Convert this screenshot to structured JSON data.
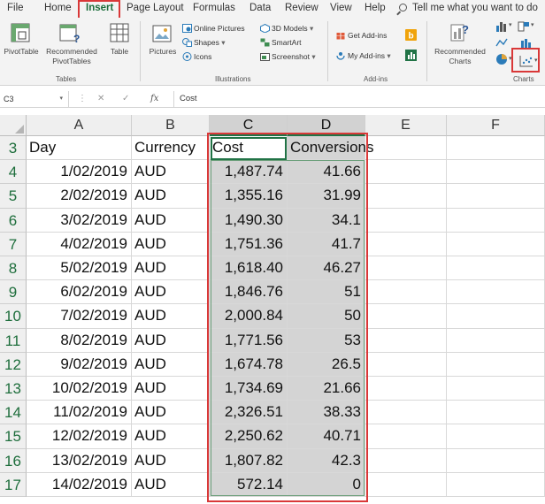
{
  "menu": {
    "tabs": [
      "File",
      "Home",
      "Insert",
      "Page Layout",
      "Formulas",
      "Data",
      "Review",
      "View",
      "Help"
    ],
    "active_tab": "Insert",
    "tell_me": "Tell me what you want to do"
  },
  "ribbon": {
    "tables": {
      "pivot_table": "PivotTable",
      "recommended_pivot_1": "Recommended",
      "recommended_pivot_2": "PivotTables",
      "table": "Table",
      "group_label": "Tables"
    },
    "illustrations": {
      "pictures": "Pictures",
      "online_pictures": "Online Pictures",
      "shapes": "Shapes",
      "icons": "Icons",
      "models_3d": "3D Models",
      "smartart": "SmartArt",
      "screenshot": "Screenshot",
      "group_label": "Illustrations"
    },
    "addins": {
      "get_addins": "Get Add-ins",
      "my_addins": "My Add-ins",
      "group_label": "Add-ins"
    },
    "charts": {
      "recommended_1": "Recommended",
      "recommended_2": "Charts",
      "group_label": "Charts"
    }
  },
  "formula_bar": {
    "name_box": "C3",
    "fx": "fx",
    "content": "Cost"
  },
  "grid": {
    "columns": [
      "A",
      "B",
      "C",
      "D",
      "E",
      "F"
    ],
    "selected_columns": [
      "C",
      "D"
    ],
    "rows": [
      {
        "num": "3",
        "day": "Day",
        "currency": "Currency",
        "cost": "Cost",
        "conversions": "Conversions"
      },
      {
        "num": "4",
        "day": "1/02/2019",
        "currency": "AUD",
        "cost": "1,487.74",
        "conversions": "41.66"
      },
      {
        "num": "5",
        "day": "2/02/2019",
        "currency": "AUD",
        "cost": "1,355.16",
        "conversions": "31.99"
      },
      {
        "num": "6",
        "day": "3/02/2019",
        "currency": "AUD",
        "cost": "1,490.30",
        "conversions": "34.1"
      },
      {
        "num": "7",
        "day": "4/02/2019",
        "currency": "AUD",
        "cost": "1,751.36",
        "conversions": "41.7"
      },
      {
        "num": "8",
        "day": "5/02/2019",
        "currency": "AUD",
        "cost": "1,618.40",
        "conversions": "46.27"
      },
      {
        "num": "9",
        "day": "6/02/2019",
        "currency": "AUD",
        "cost": "1,846.76",
        "conversions": "51"
      },
      {
        "num": "10",
        "day": "7/02/2019",
        "currency": "AUD",
        "cost": "2,000.84",
        "conversions": "50"
      },
      {
        "num": "11",
        "day": "8/02/2019",
        "currency": "AUD",
        "cost": "1,771.56",
        "conversions": "53"
      },
      {
        "num": "12",
        "day": "9/02/2019",
        "currency": "AUD",
        "cost": "1,674.78",
        "conversions": "26.5"
      },
      {
        "num": "13",
        "day": "10/02/2019",
        "currency": "AUD",
        "cost": "1,734.69",
        "conversions": "21.66"
      },
      {
        "num": "14",
        "day": "11/02/2019",
        "currency": "AUD",
        "cost": "2,326.51",
        "conversions": "38.33"
      },
      {
        "num": "15",
        "day": "12/02/2019",
        "currency": "AUD",
        "cost": "2,250.62",
        "conversions": "40.71"
      },
      {
        "num": "16",
        "day": "13/02/2019",
        "currency": "AUD",
        "cost": "1,807.82",
        "conversions": "42.3"
      },
      {
        "num": "17",
        "day": "14/02/2019",
        "currency": "AUD",
        "cost": "572.14",
        "conversions": "0"
      }
    ]
  },
  "colors": {
    "excel_green": "#217346",
    "highlight_red": "#d93838",
    "selection_gray": "#d4d4d4"
  }
}
